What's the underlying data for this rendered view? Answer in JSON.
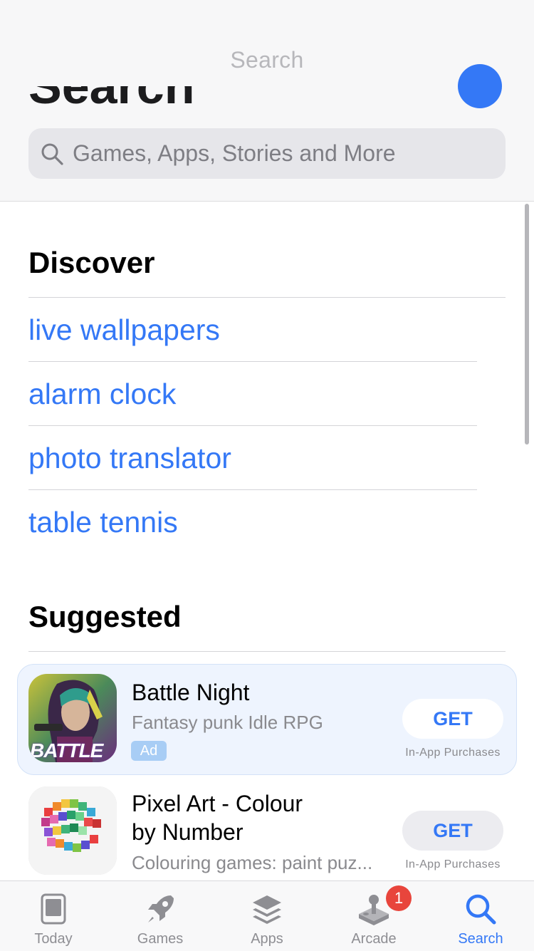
{
  "header": {
    "nav_title": "Search",
    "large_title": "Search",
    "search_placeholder": "Games, Apps, Stories and More"
  },
  "discover": {
    "title": "Discover",
    "items": [
      "live wallpapers",
      "alarm clock",
      "photo translator",
      "table tennis"
    ]
  },
  "suggested": {
    "title": "Suggested",
    "apps": [
      {
        "name": "Battle Night",
        "subtitle": "Fantasy punk Idle RPG",
        "badge": "Ad",
        "button": "GET",
        "iap": "In-App Purchases",
        "icon": "battle-night-app-icon",
        "icon_text": "BATTLE"
      },
      {
        "name_line1": "Pixel Art - Colour",
        "name_line2": "by Number",
        "subtitle": "Colouring games: paint puz...",
        "button": "GET",
        "iap": "In-App Purchases",
        "icon": "pixel-art-app-icon"
      }
    ]
  },
  "tabbar": {
    "tabs": [
      {
        "label": "Today",
        "icon": "today-icon"
      },
      {
        "label": "Games",
        "icon": "rocket-icon"
      },
      {
        "label": "Apps",
        "icon": "layers-icon"
      },
      {
        "label": "Arcade",
        "icon": "joystick-icon",
        "badge": "1"
      },
      {
        "label": "Search",
        "icon": "search-icon",
        "active": true
      }
    ]
  },
  "colors": {
    "accent": "#3478f6",
    "badge": "#e8453c",
    "ad_card": "#eef4fe"
  }
}
